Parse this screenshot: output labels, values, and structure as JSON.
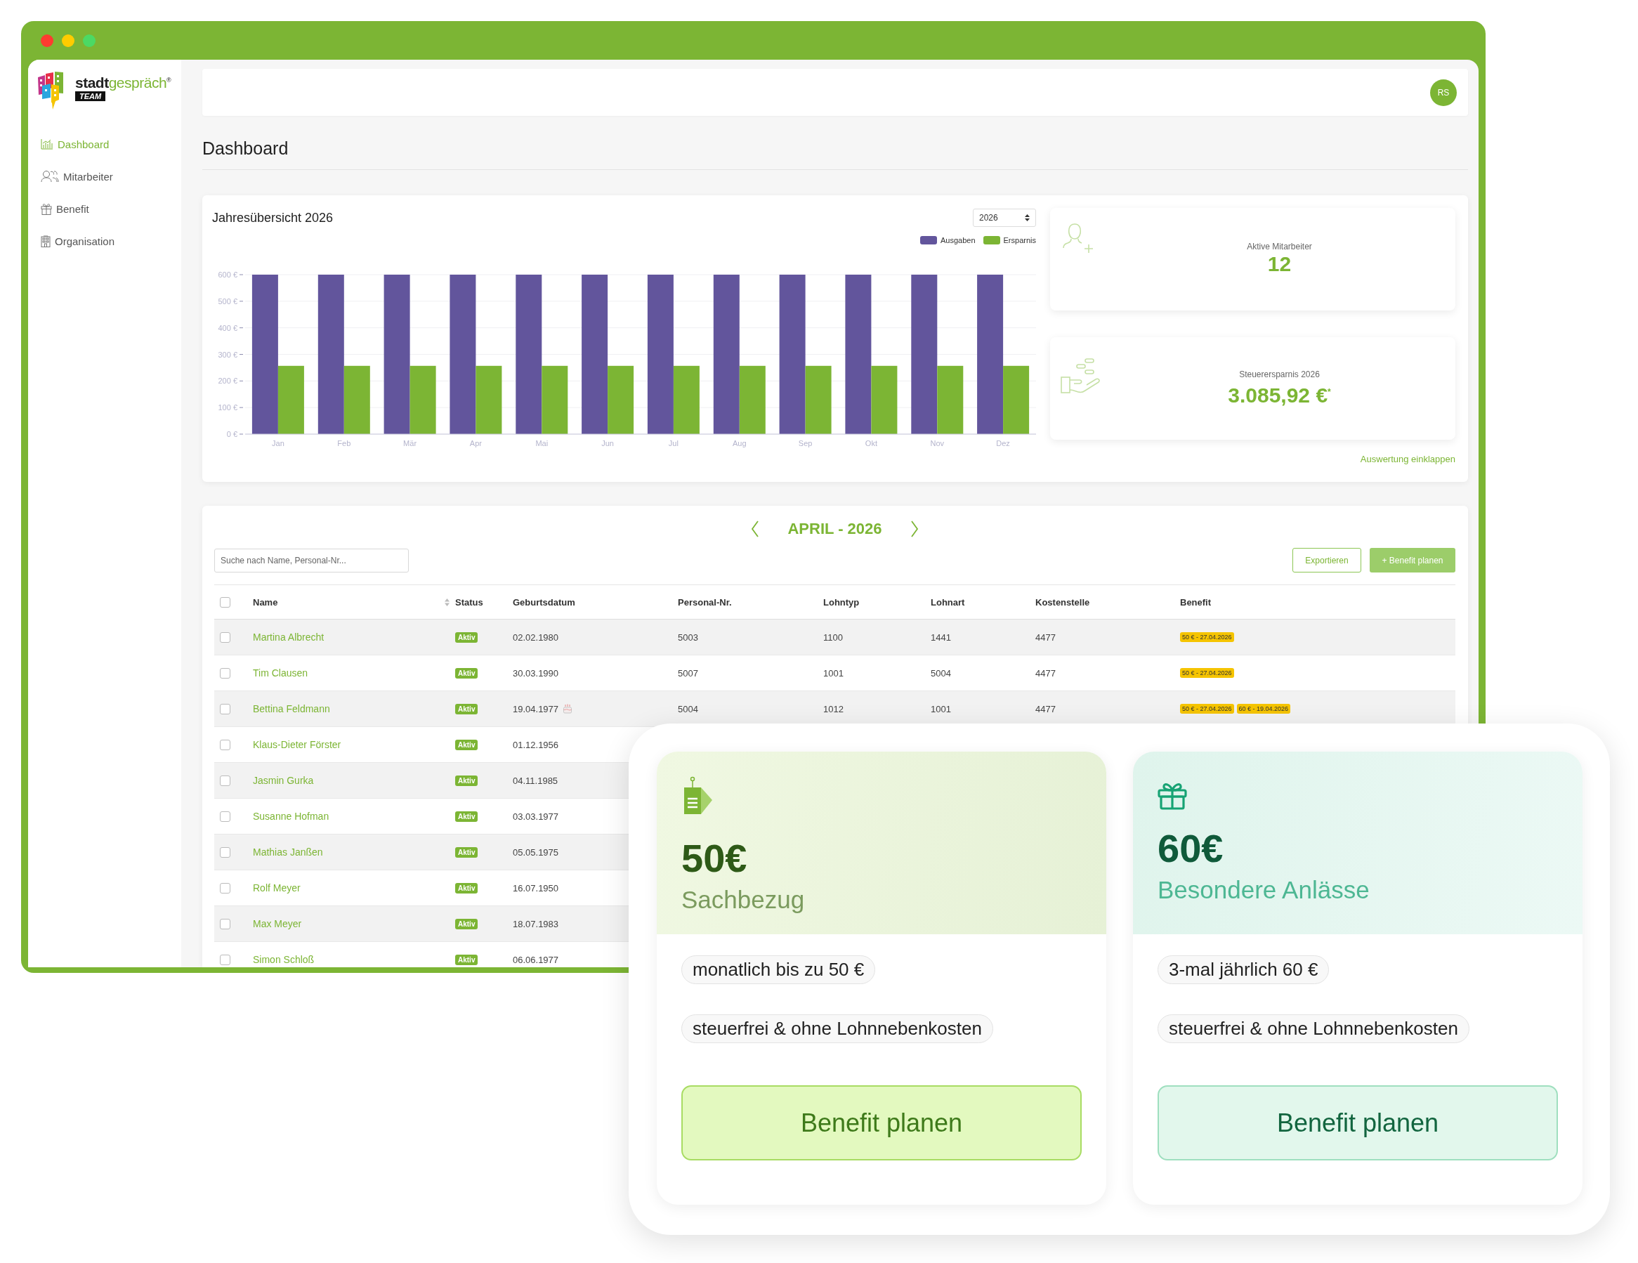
{
  "window": {
    "controls": [
      {
        "kind": "close"
      },
      {
        "kind": "minimize"
      },
      {
        "kind": "maximize"
      }
    ]
  },
  "logo": {
    "wordmark_dark": "stadt",
    "wordmark_light": "gespräch$^{®}$",
    "badge": "TEAM"
  },
  "sidebar": {
    "items": [
      {
        "kind": "chart",
        "label": "Dashboard",
        "selected": true
      },
      {
        "kind": "people",
        "label": "Mitarbeiter",
        "selected": false
      },
      {
        "kind": "gift",
        "label": "Benefit",
        "selected": false
      },
      {
        "kind": "building",
        "label": "Organisation",
        "selected": false
      }
    ]
  },
  "header": {
    "avatar": "RS"
  },
  "page_title": "Dashboard",
  "overview": {
    "title": "Jahresübersicht 2026",
    "year_select": "2026",
    "chart_data": {
      "type": "bar",
      "categories": [
        "Jan",
        "Feb",
        "Mär",
        "Apr",
        "Mai",
        "Jun",
        "Jul",
        "Aug",
        "Sep",
        "Okt",
        "Nov",
        "Dez"
      ],
      "series": [
        {
          "name": "Ausgaben",
          "color": "#62559c",
          "values": [
            600,
            600,
            600,
            600,
            600,
            600,
            600,
            600,
            600,
            600,
            600,
            600
          ]
        },
        {
          "name": "Ersparnis",
          "color": "#7cb534",
          "values": [
            257,
            257,
            257,
            257,
            257,
            257,
            257,
            257,
            257,
            257,
            257,
            257
          ]
        }
      ],
      "ylim": [
        0,
        600
      ],
      "grid": true,
      "yticks": [
        {
          "value": 0,
          "label": "0 €"
        },
        {
          "value": 100,
          "label": "100 €"
        },
        {
          "value": 200,
          "label": "200 €"
        },
        {
          "value": 300,
          "label": "300 €"
        },
        {
          "value": 400,
          "label": "400 €"
        },
        {
          "value": 500,
          "label": "500 €"
        },
        {
          "value": 600,
          "label": "600 €"
        }
      ]
    },
    "stats": [
      {
        "kind": "employees",
        "label": "Aktive Mitarbeiter",
        "value": "12"
      },
      {
        "kind": "savings",
        "label": "Steuerersparnis 2026",
        "value": "3.085,92 €$^{*}$"
      }
    ],
    "collapse_link": "Auswertung einklappen"
  },
  "month_nav": {
    "label": "APRIL - 2026"
  },
  "search": {
    "placeholder": "Suche nach Name, Personal-Nr..."
  },
  "buttons": [
    {
      "kind": "outline",
      "label": "Exportieren"
    },
    {
      "kind": "primary",
      "label": "+ Benefit planen"
    }
  ],
  "table": {
    "select_all_checked": false,
    "columns": [
      {
        "kind": "link",
        "label": "Name",
        "sortable": true
      },
      {
        "kind": "badge",
        "label": "Status",
        "sortable": false
      },
      {
        "kind": "date",
        "label": "Geburtsdatum",
        "sortable": false
      },
      {
        "kind": "text",
        "label": "Personal-Nr.",
        "sortable": false
      },
      {
        "kind": "text",
        "label": "Lohntyp",
        "sortable": false
      },
      {
        "kind": "text",
        "label": "Lohnart",
        "sortable": false
      },
      {
        "kind": "text",
        "label": "Kostenstelle",
        "sortable": false
      },
      {
        "kind": "tags",
        "label": "Benefit",
        "sortable": false
      }
    ],
    "rows": [
      {
        "checked": false,
        "birthday": false,
        "cells": [
          "Martina Albrecht",
          "Aktiv",
          "02.02.1980",
          "5003",
          "1100",
          "1441",
          "4477",
          [
            "50 € - 27.04.2026"
          ]
        ]
      },
      {
        "checked": false,
        "birthday": false,
        "cells": [
          "Tim Clausen",
          "Aktiv",
          "30.03.1990",
          "5007",
          "1001",
          "5004",
          "4477",
          [
            "50 € - 27.04.2026"
          ]
        ]
      },
      {
        "checked": false,
        "birthday": true,
        "cells": [
          "Bettina Feldmann",
          "Aktiv",
          "19.04.1977",
          "5004",
          "1012",
          "1001",
          "4477",
          [
            "50 € - 27.04.2026",
            "60 € - 19.04.2026"
          ]
        ]
      },
      {
        "checked": false,
        "birthday": false,
        "cells": [
          "Klaus-Dieter Förster",
          "Aktiv",
          "01.12.1956"
        ]
      },
      {
        "checked": false,
        "birthday": false,
        "cells": [
          "Jasmin Gurka",
          "Aktiv",
          "04.11.1985"
        ]
      },
      {
        "checked": false,
        "birthday": false,
        "cells": [
          "Susanne Hofman",
          "Aktiv",
          "03.03.1977"
        ]
      },
      {
        "checked": false,
        "birthday": false,
        "cells": [
          "Mathias Janßen",
          "Aktiv",
          "05.05.1975"
        ]
      },
      {
        "checked": false,
        "birthday": false,
        "cells": [
          "Rolf Meyer",
          "Aktiv",
          "16.07.1950"
        ]
      },
      {
        "checked": false,
        "birthday": false,
        "cells": [
          "Max Meyer",
          "Aktiv",
          "18.07.1983"
        ]
      },
      {
        "checked": false,
        "birthday": false,
        "cells": [
          "Simon Schloß",
          "Aktiv",
          "06.06.1977"
        ]
      }
    ]
  },
  "promo": {
    "cards": [
      {
        "kind": "sachbezug",
        "amount": "50€",
        "title": "Sachbezug",
        "features": [
          "monatlich bis zu 50 €",
          "steuerfrei & ohne Lohnnebenkosten"
        ],
        "button": "Benefit planen"
      },
      {
        "kind": "anlaesse",
        "amount": "60€",
        "title": "Besondere Anlässe",
        "features": [
          "3-mal jährlich 60 €",
          "steuerfrei & ohne Lohnnebenkosten"
        ],
        "button": "Benefit planen"
      }
    ]
  }
}
